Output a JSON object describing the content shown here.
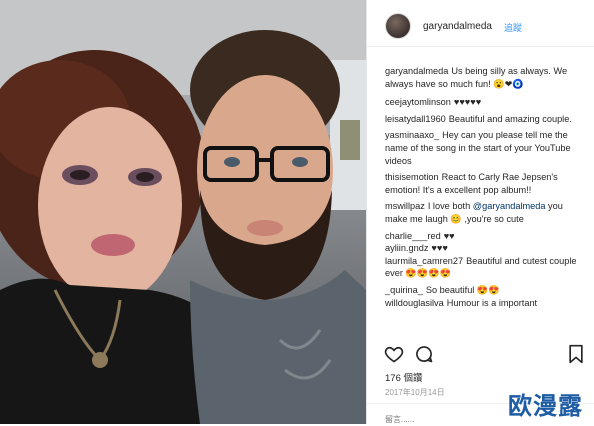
{
  "post": {
    "username": "garyandalmeda",
    "follow_label": "追蹤",
    "comments": [
      {
        "user": "garyandalmeda",
        "text": "Us being silly as always. We always have so much fun! 😮❤🧿"
      },
      {
        "user": "ceejaytomlinson",
        "text": "♥♥♥♥♥"
      },
      {
        "user": "leisatydall1960",
        "text": "Beautiful and amazing couple."
      },
      {
        "user": "yasminaaxo_",
        "text": "Hey can you please tell me the name of the song in the start of your YouTube videos"
      },
      {
        "user": "thisisemotion",
        "text": "React to Carly Rae Jepsen's emotion! It's a excellent pop album!!"
      },
      {
        "user": "mswillpaz",
        "text_before": "I love both",
        "mention": "@garyandalmeda",
        "text_after": "you make me laugh 😊 ,you're so cute"
      },
      {
        "user": "charlie___red",
        "text": "♥♥"
      },
      {
        "user": "ayliin.gndz",
        "text": "♥♥♥"
      },
      {
        "user": "laurmila_camren27",
        "text": "Beautiful and cutest couple ever 😍😍😍😍"
      },
      {
        "user": "_quirina_",
        "text": "So beautiful 😍😍"
      },
      {
        "user": "willdouglasilva",
        "text": "Humour is a important"
      }
    ],
    "likes": "176 個讚",
    "date": "2017年10月14日",
    "comment_placeholder": "留言......"
  },
  "watermark": "欧漫露",
  "colors": {
    "link": "#3897f0",
    "text": "#262626",
    "muted": "#999999",
    "watermark": "#1e5ca3"
  }
}
